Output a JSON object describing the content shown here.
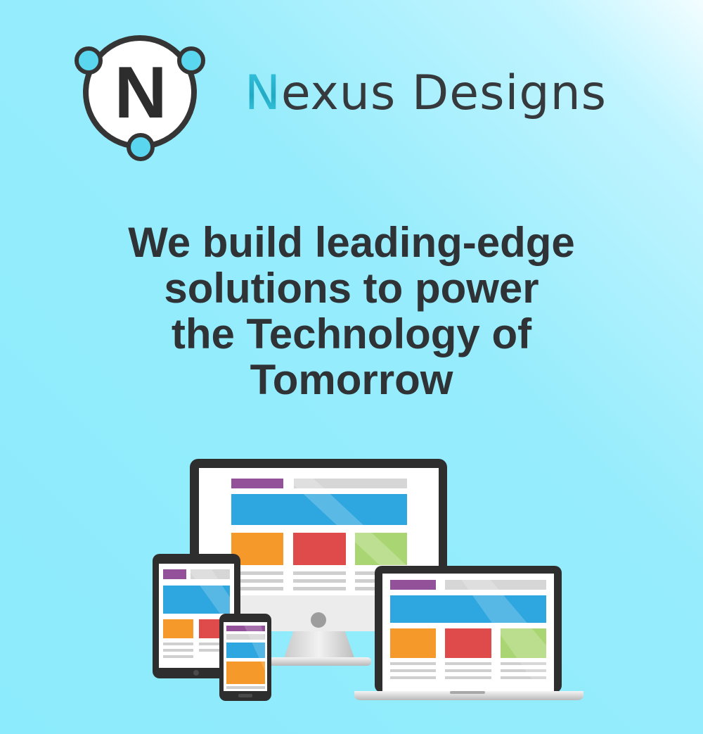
{
  "brand": {
    "logo_letter": "N",
    "name_initial": "N",
    "name_rest": "exus Designs",
    "colors": {
      "accent": "#4fd2ec",
      "text": "#373a3d",
      "logo_ring": "#353535"
    }
  },
  "headline": {
    "lines": [
      "We build leading-edge",
      "solutions to power",
      "the Technology of",
      "Tomorrow"
    ]
  },
  "illustration": {
    "devices": [
      "desktop-monitor",
      "tablet",
      "smartphone",
      "laptop"
    ],
    "colors": {
      "purple": "#93519a",
      "blue": "#2ea6df",
      "orange": "#f59a2a",
      "red": "#df4a4a",
      "green": "#a9d672",
      "gray": "#d9d9d9",
      "bezel": "#2e2e2e"
    }
  }
}
